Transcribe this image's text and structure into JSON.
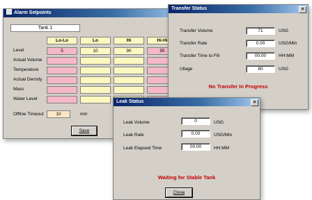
{
  "alarm": {
    "title": "Alarm Setpoints",
    "tank": "Tank 1",
    "headers": [
      "Lo-Lo",
      "Lo",
      "Hi",
      "Hi-Hi"
    ],
    "rows": [
      {
        "label": "Level",
        "values": [
          "5",
          "10",
          "90",
          "95"
        ]
      },
      {
        "label": "Actual Volume",
        "values": [
          "",
          "",
          "",
          ""
        ]
      },
      {
        "label": "Temperature",
        "values": [
          "",
          "",
          "",
          ""
        ]
      },
      {
        "label": "Actual Density",
        "values": [
          "",
          "",
          "",
          ""
        ]
      },
      {
        "label": "Mass",
        "values": [
          "",
          "",
          "",
          ""
        ]
      },
      {
        "label": "Water Level",
        "values": [
          "",
          "",
          "",
          ""
        ]
      }
    ],
    "offline_label": "Offline Timeout",
    "offline_value": "10",
    "offline_unit": "min",
    "save_label": "Save",
    "close_symbol": "×"
  },
  "transfer": {
    "title": "Transfer Status",
    "rows": [
      {
        "label": "Transfer Volume",
        "value": "71",
        "unit": "USG"
      },
      {
        "label": "Transfer Rate",
        "value": "0.00",
        "unit": "USG/Min"
      },
      {
        "label": "Transfer Time to Fill",
        "value": "00:00",
        "unit": "HH:MM"
      },
      {
        "label": "Ullage",
        "value": "80",
        "unit": "USG"
      }
    ],
    "message": "No Transfer In Progress",
    "close_symbol": "×"
  },
  "leak": {
    "title": "Leak Status",
    "rows": [
      {
        "label": "Leak Volume",
        "value": "0",
        "unit": "USG"
      },
      {
        "label": "Leak Rate",
        "value": "0.00",
        "unit": "USG/Min"
      },
      {
        "label": "Leak Elapsed Time",
        "value": "00:00",
        "unit": "HH:MM"
      }
    ],
    "message": "Waiting for Stable Tank",
    "close_label": "Close",
    "close_symbol": "×"
  },
  "colors": {
    "title_start": "#0a246a",
    "pink": "#f4b8c8",
    "yellow": "#fdf8c0",
    "status_red": "#c00000"
  }
}
